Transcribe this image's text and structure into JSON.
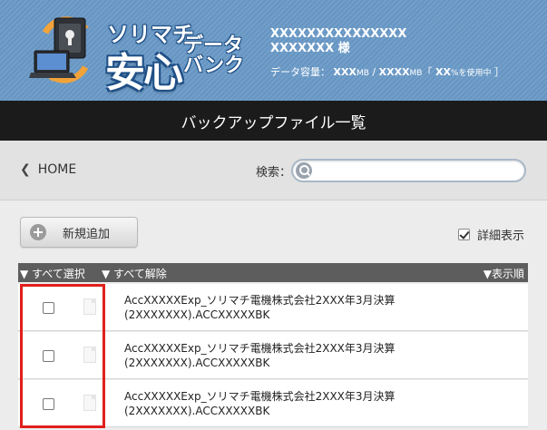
{
  "header": {
    "logo": {
      "line1": "ソリマチ",
      "line2": "安心",
      "line3a": "データ",
      "line3b": "バンク"
    },
    "user_line1": "XXXXXXXXXXXXXXX",
    "user_line2": "XXXXXXX 様",
    "usage": {
      "prefix": "データ容量：",
      "used": "XXX",
      "unit1": "MB",
      "sep": " / ",
      "total": "XXXX",
      "unit2": "MB",
      "open": "「",
      "pct": "XX",
      "pct_suffix": "%を使用中",
      "close": "］"
    }
  },
  "title_bar": {
    "title": "バックアップファイル一覧"
  },
  "nav": {
    "home_label": "HOME",
    "search_label": "検索：",
    "search_value": ""
  },
  "toolbar": {
    "add_label": "新規追加",
    "detail_label": "詳細表示",
    "detail_checked": true
  },
  "table": {
    "select_all": "▼ すべて選択",
    "deselect_all": "▼ すべて解除",
    "sort_label": "▼表示順",
    "rows": [
      {
        "line1": "AccXXXXXExp_ソリマチ電機株式会社2XXX年3月決算",
        "line2": "(2XXXXXXX).ACCXXXXXBK"
      },
      {
        "line1": "AccXXXXXExp_ソリマチ電機株式会社2XXX年3月決算",
        "line2": "(2XXXXXXX).ACCXXXXXBK"
      },
      {
        "line1": "AccXXXXXExp_ソリマチ電機株式会社2XXX年3月決算",
        "line2": "(2XXXXXXX).ACCXXXXXBK"
      }
    ]
  },
  "colors": {
    "header_bg": "#6a9ac7",
    "title_bar_bg": "#1b1b1b",
    "highlight": "#e0201c"
  }
}
